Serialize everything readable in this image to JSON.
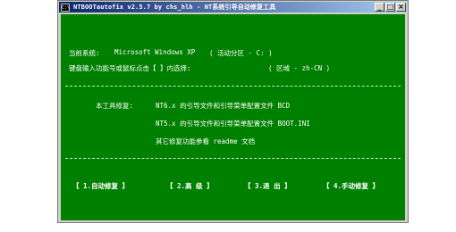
{
  "window": {
    "icon_label": "C:\\",
    "title": "NTBOOTautofix v2.5.7 by chs_hlh - NT系统引导自动修复工具",
    "buttons": {
      "minimize": "_",
      "maximize": "□",
      "close": "×"
    }
  },
  "console": {
    "system_label": "当前系统:",
    "system_value": "Microsoft Windows XP",
    "partition": "( 活动分区 - C: )",
    "prompt": "键盘输入功能号或鼠标点击【 】内选择:",
    "region": "( 区域 - zh-CN )",
    "repair_label": "本工具修复:",
    "nt6_line": "NT6.x 的引导文件和引导菜单配置文件 BCD",
    "nt5_line": "NT5.x 的引导文件和引导菜单配置文件 BOOT.INI",
    "other_line": "其它修复功能参看 readme 文档"
  },
  "menu": {
    "auto": "【 1.自动修复 】",
    "advanced": "【 2.高  级 】",
    "exit": "【 3.退  出 】",
    "manual": "【 4.手动修复 】"
  }
}
